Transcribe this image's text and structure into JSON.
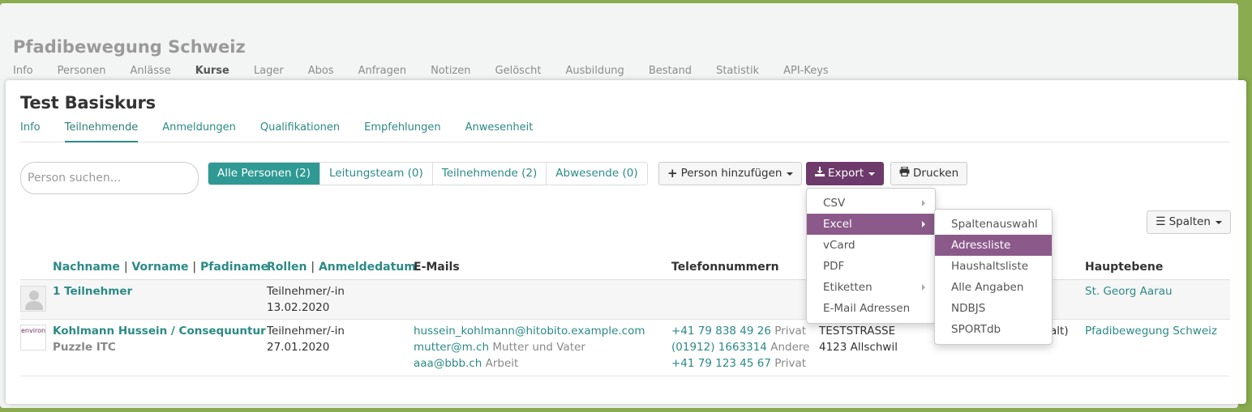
{
  "background": {
    "group_title": "Pfadibewegung Schweiz",
    "nav": [
      "Info",
      "Personen",
      "Anlässe",
      "Kurse",
      "Lager",
      "Abos",
      "Anfragen",
      "Notizen",
      "Gelöscht",
      "Ausbildung",
      "Bestand",
      "Statistik",
      "API-Keys"
    ]
  },
  "course": {
    "title": "Test Basiskurs",
    "tabs": [
      "Info",
      "Teilnehmende",
      "Anmeldungen",
      "Qualifikationen",
      "Empfehlungen",
      "Anwesenheit"
    ]
  },
  "search": {
    "placeholder": "Person suchen..."
  },
  "filters": [
    "Alle Personen (2)",
    "Leitungsteam (0)",
    "Teilnehmende (2)",
    "Abwesende (0)"
  ],
  "buttons": {
    "add_person": "Person hinzufügen",
    "export": "Export",
    "print": "Drucken",
    "columns": "Spalten"
  },
  "table": {
    "headers": {
      "name_parts": [
        "Nachname",
        "Vorname",
        "Pfadiname"
      ],
      "separator": "|",
      "role_parts": [
        "Rollen",
        "Anmeldedatum"
      ],
      "emails": "E-Mails",
      "phones": "Telefonnummern",
      "main_level": "Hauptebene"
    },
    "rows": [
      {
        "name": "1 Teilnehmer",
        "role": "Teilnehmer/-in",
        "date": "13.02.2020",
        "main_level": "St. Georg Aarau"
      },
      {
        "name": "Kohlmann Hussein / Consequuntur",
        "company": "Puzzle ITC",
        "role": "Teilnehmer/-in",
        "date": "27.01.2020",
        "emails": [
          {
            "address": "hussein_kohlmann@hitobito.example.com",
            "label": ""
          },
          {
            "address": "mutter@m.ch",
            "label": "Mutter und Vater"
          },
          {
            "address": "aaa@bbb.ch",
            "label": "Arbeit"
          }
        ],
        "phones": [
          {
            "number": "+41 79 838 49 26",
            "label": "Privat"
          },
          {
            "number": "(01912) 1663314",
            "label": "Andere"
          },
          {
            "number": "+41 79 123 45 67",
            "label": "Privat"
          }
        ],
        "address_street": "TESTSTRASSE",
        "address_city": "4123 Allschwil",
        "address_partial": "alt)",
        "main_level": "Pfadibewegung Schweiz",
        "logo_text": "environ"
      }
    ]
  },
  "export_menu": {
    "items": [
      "CSV",
      "Excel",
      "vCard",
      "PDF",
      "Etiketten",
      "E-Mail Adressen"
    ],
    "active": "Excel"
  },
  "excel_submenu": {
    "items": [
      "Spaltenauswahl",
      "Adressliste",
      "Haushaltsliste",
      "Alle Angaben",
      "NDBJS",
      "SPORTdb"
    ],
    "active": "Adressliste"
  },
  "colors": {
    "accent": "#2b8a86",
    "export_button": "#6d3a6b",
    "menu_highlight": "#8b5a8b",
    "page_background": "#8aab4f"
  }
}
